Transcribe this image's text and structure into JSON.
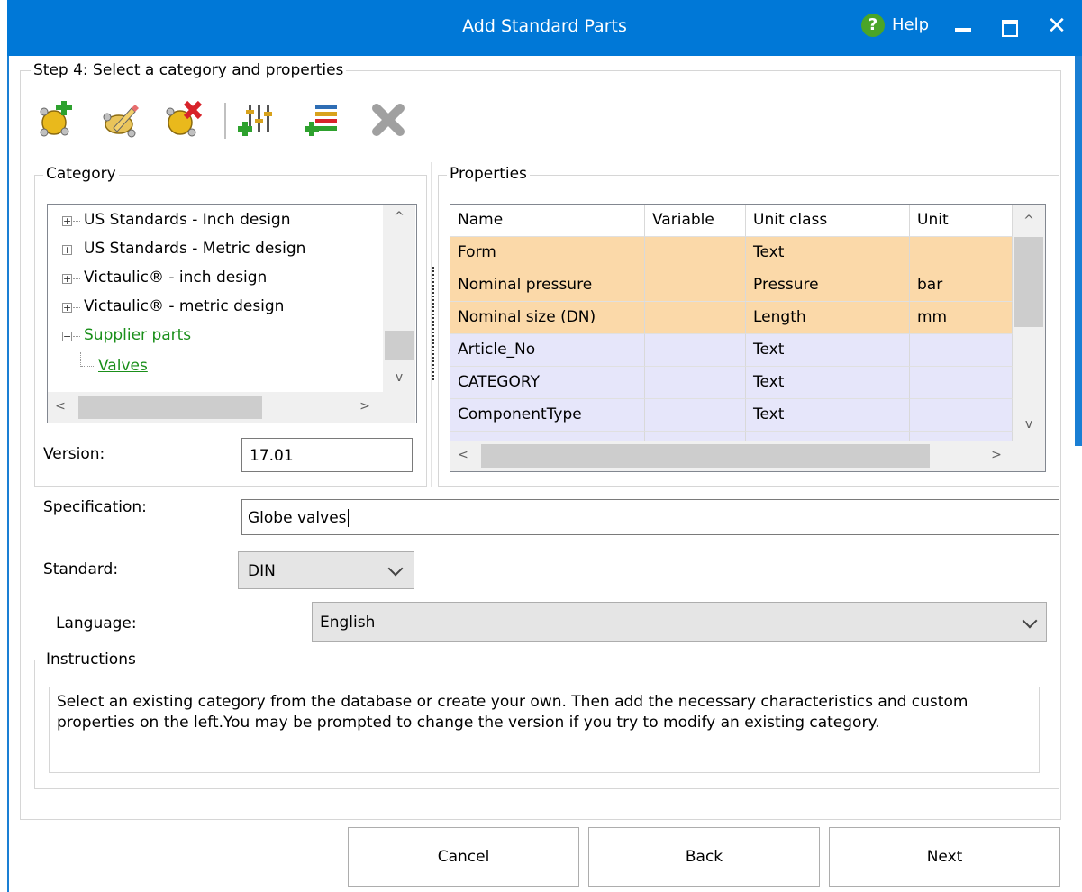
{
  "window": {
    "title": "Add Standard Parts",
    "help_label": "Help",
    "accent_color": "#0078d7"
  },
  "step": {
    "title": "Step 4: Select a category and properties"
  },
  "toolbar": {
    "icons": [
      "add-category-icon",
      "edit-category-icon",
      "delete-category-icon",
      "properties-settings-icon",
      "add-property-icon",
      "delete-property-icon"
    ]
  },
  "category": {
    "group_title": "Category",
    "tree": [
      {
        "label": "US Standards - Inch design",
        "expander": "+"
      },
      {
        "label": "US Standards - Metric design",
        "expander": "+"
      },
      {
        "label": "Victaulic® - inch design",
        "expander": "+"
      },
      {
        "label": "Victaulic® - metric design",
        "expander": "+"
      },
      {
        "label": "Supplier parts",
        "expander": "−"
      },
      {
        "label": "Valves",
        "expander": ""
      }
    ],
    "version_label": "Version:",
    "version_value": "17.01"
  },
  "properties": {
    "group_title": "Properties",
    "columns": [
      "Name",
      "Variable",
      "Unit class",
      "Unit"
    ],
    "rows": [
      {
        "name": "Form",
        "variable": "",
        "unit_class": "Text",
        "unit": "",
        "highlight": "orange"
      },
      {
        "name": "Nominal pressure",
        "variable": "",
        "unit_class": "Pressure",
        "unit": "bar",
        "highlight": "orange"
      },
      {
        "name": "Nominal size (DN)",
        "variable": "",
        "unit_class": "Length",
        "unit": "mm",
        "highlight": "orange"
      },
      {
        "name": "Article_No",
        "variable": "",
        "unit_class": "Text",
        "unit": "",
        "highlight": "blue"
      },
      {
        "name": "CATEGORY",
        "variable": "",
        "unit_class": "Text",
        "unit": "",
        "highlight": "blue"
      },
      {
        "name": "ComponentType",
        "variable": "",
        "unit_class": "Text",
        "unit": "",
        "highlight": "blue"
      }
    ],
    "colors": {
      "orange": "#fbd9a9",
      "blue": "#e6e6fa"
    }
  },
  "form": {
    "specification_label": "Specification:",
    "specification_value": "Globe valves",
    "standard_label": "Standard:",
    "standard_value": "DIN",
    "language_label": "Language:",
    "language_value": "English"
  },
  "instructions": {
    "group_title": "Instructions",
    "text": "Select an existing category from the database or create your own. Then add the necessary characteristics and custom properties on the left.You may be prompted to change the version if you try to modify an existing category."
  },
  "buttons": {
    "cancel": "Cancel",
    "back": "Back",
    "next": "Next"
  }
}
